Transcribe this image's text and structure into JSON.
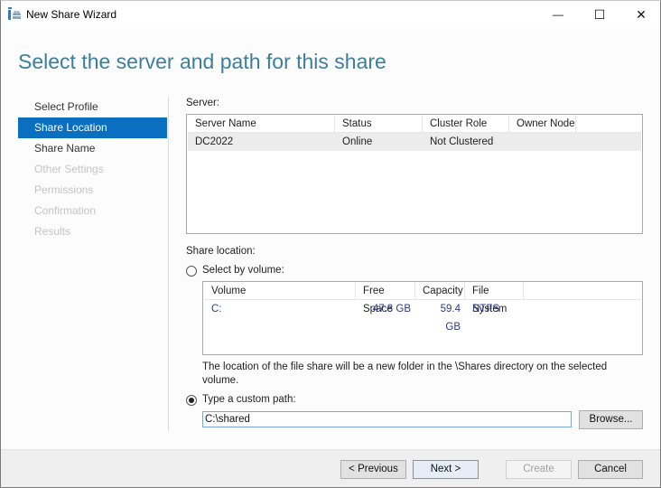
{
  "window": {
    "title": "New Share Wizard",
    "controls": {
      "minimize": "—",
      "maximize": "☐",
      "close": "✕"
    }
  },
  "heading": "Select the server and path for this share",
  "nav": {
    "items": [
      {
        "label": "Select Profile",
        "state": "normal"
      },
      {
        "label": "Share Location",
        "state": "active"
      },
      {
        "label": "Share Name",
        "state": "normal"
      },
      {
        "label": "Other Settings",
        "state": "disabled"
      },
      {
        "label": "Permissions",
        "state": "disabled"
      },
      {
        "label": "Confirmation",
        "state": "disabled"
      },
      {
        "label": "Results",
        "state": "disabled"
      }
    ]
  },
  "server": {
    "label": "Server:",
    "columns": [
      "Server Name",
      "Status",
      "Cluster Role",
      "Owner Node"
    ],
    "rows": [
      {
        "server_name": "DC2022",
        "status": "Online",
        "cluster_role": "Not Clustered",
        "owner_node": ""
      }
    ]
  },
  "share_location": {
    "label": "Share location:",
    "by_volume_label": "Select by volume:",
    "by_volume_selected": false,
    "volume_columns": [
      "Volume",
      "Free Space",
      "Capacity",
      "File System"
    ],
    "volumes": [
      {
        "volume": "C:",
        "free_space": "47.8 GB",
        "capacity": "59.4 GB",
        "file_system": "NTFS"
      }
    ],
    "note": "The location of the file share will be a new folder in the \\Shares directory on the selected volume.",
    "custom_path_label": "Type a custom path:",
    "custom_path_selected": true,
    "custom_path_value": "C:\\shared",
    "browse_label": "Browse..."
  },
  "footer": {
    "previous": "< Previous",
    "next": "Next >",
    "create": "Create",
    "cancel": "Cancel"
  },
  "colors": {
    "accent": "#0a6fc0",
    "heading": "#3b7f9a",
    "volume_text": "#2b3a8c"
  }
}
